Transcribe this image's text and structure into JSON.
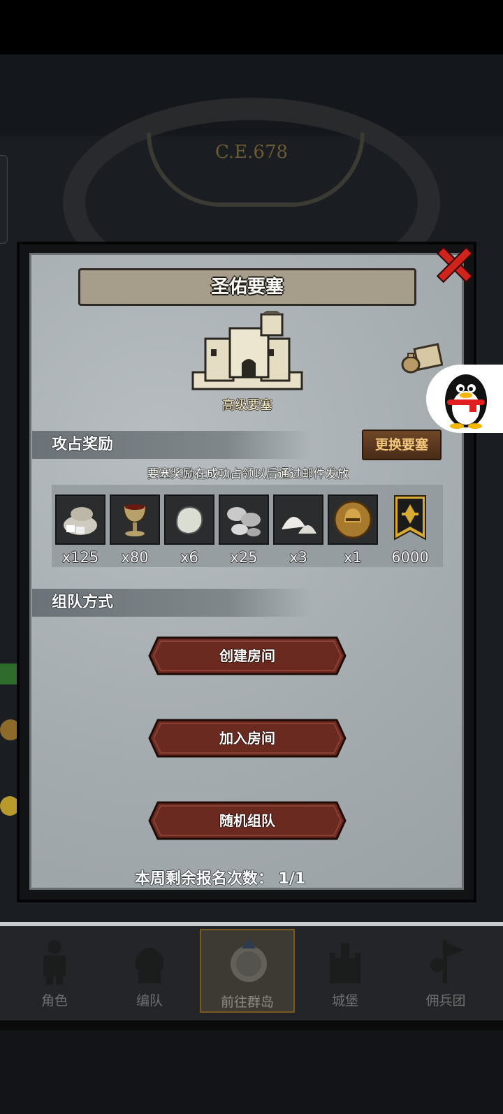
{
  "background": {
    "year_text": "C.E.678"
  },
  "dialog": {
    "title": "圣佑要塞",
    "fortress_label": "高级要塞",
    "close_icon": "close-x-icon"
  },
  "rewards_section": {
    "header": "攻占奖励",
    "change_button": "更换要塞",
    "note": "要塞奖励在成功占领以后通过邮件发放",
    "items": [
      {
        "icon": "silver-pile-icon",
        "count": "x125"
      },
      {
        "icon": "goblet-icon",
        "count": "x80"
      },
      {
        "icon": "pearl-stone-icon",
        "count": "x6"
      },
      {
        "icon": "metal-ore-icon",
        "count": "x25"
      },
      {
        "icon": "salt-pile-icon",
        "count": "x3"
      },
      {
        "icon": "knight-helmet-coin-icon",
        "count": "x1"
      },
      {
        "icon": "guild-banner-icon",
        "count": "6000"
      }
    ]
  },
  "team_section": {
    "header": "组队方式",
    "buttons": [
      "创建房间",
      "加入房间",
      "随机组队"
    ],
    "remaining_label": "本周剩余报名次数：",
    "remaining_value": "1/1"
  },
  "bottom_nav": {
    "items": [
      {
        "label": "角色",
        "icon": "character-icon",
        "active": false
      },
      {
        "label": "编队",
        "icon": "squad-icon",
        "active": false
      },
      {
        "label": "前往群岛",
        "icon": "compass-islands-icon",
        "active": true
      },
      {
        "label": "城堡",
        "icon": "castle-icon",
        "active": false
      },
      {
        "label": "佣兵团",
        "icon": "mercenary-icon",
        "active": false
      }
    ]
  },
  "colors": {
    "accent_red": "#d0231b",
    "button_brown": "#6e4628",
    "gold_text": "#f3c87c"
  }
}
